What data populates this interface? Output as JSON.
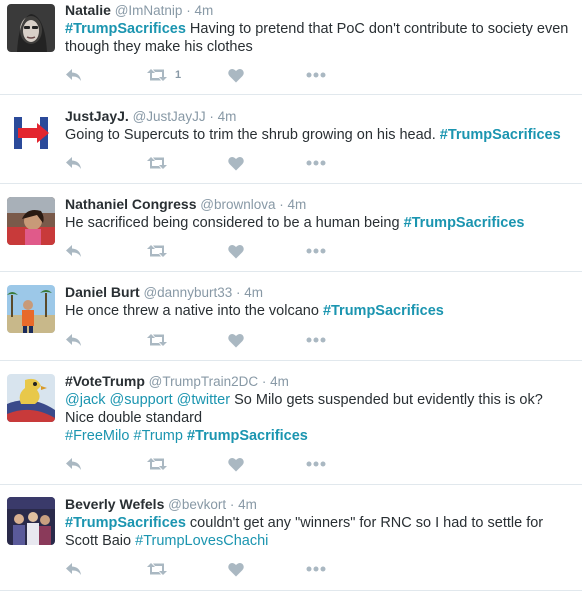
{
  "tweets": [
    {
      "name": "Natalie",
      "handle": "@ImNatnip",
      "time": "4m",
      "parts": [
        {
          "t": "#TrumpSacrifices",
          "s": "hl-b"
        },
        {
          "t": " Having to pretend that PoC don't contribute to  society even though they make his clothes",
          "s": ""
        }
      ],
      "retweet_count": "1",
      "avatar": "portrait-dark"
    },
    {
      "name": "JustJayJ.",
      "handle": "@JustJayJJ",
      "time": "4m",
      "parts": [
        {
          "t": "Going to Supercuts to trim the shrub growing on his head.  ",
          "s": ""
        },
        {
          "t": "#TrumpSacrifices",
          "s": "hl-b"
        }
      ],
      "retweet_count": "",
      "avatar": "hillary-logo"
    },
    {
      "name": "Nathaniel Congress",
      "handle": "@brownlova",
      "time": "4m",
      "parts": [
        {
          "t": "He sacrificed being considered to be a human being ",
          "s": ""
        },
        {
          "t": "#TrumpSacrifices",
          "s": "hl-b"
        }
      ],
      "retweet_count": "",
      "avatar": "child-photo"
    },
    {
      "name": "Daniel Burt",
      "handle": "@dannyburt33",
      "time": "4m",
      "parts": [
        {
          "t": "He once threw a native into the volcano ",
          "s": ""
        },
        {
          "t": "#TrumpSacrifices",
          "s": "hl-b"
        }
      ],
      "retweet_count": "",
      "avatar": "beach-photo"
    },
    {
      "name": "#VoteTrump",
      "handle": "@TrumpTrain2DC",
      "time": "4m",
      "parts": [
        {
          "t": "@jack",
          "s": "hl"
        },
        {
          "t": " ",
          "s": ""
        },
        {
          "t": "@support",
          "s": "hl"
        },
        {
          "t": " ",
          "s": ""
        },
        {
          "t": "@twitter",
          "s": "hl"
        },
        {
          "t": " So Milo gets suspended but evidently this is ok? Nice double standard",
          "s": ""
        },
        {
          "t": "BR",
          "s": "br"
        },
        {
          "t": "#FreeMilo",
          "s": "hl"
        },
        {
          "t": " ",
          "s": ""
        },
        {
          "t": "#Trump",
          "s": "hl"
        },
        {
          "t": " ",
          "s": ""
        },
        {
          "t": "#TrumpSacrifices",
          "s": "hl-b"
        }
      ],
      "retweet_count": "",
      "avatar": "eagle-flag"
    },
    {
      "name": "Beverly Wefels",
      "handle": "@bevkort",
      "time": "4m",
      "parts": [
        {
          "t": "#TrumpSacrifices",
          "s": "hl-b"
        },
        {
          "t": "  couldn't get any \"winners\" for RNC so I had to settle for Scott Baio ",
          "s": ""
        },
        {
          "t": "#TrumpLovesChachi",
          "s": "hl"
        }
      ],
      "retweet_count": "",
      "avatar": "group-photo"
    }
  ],
  "icons": {
    "reply": "reply-icon",
    "retweet": "retweet-icon",
    "like": "heart-icon",
    "more": "more-icon"
  }
}
